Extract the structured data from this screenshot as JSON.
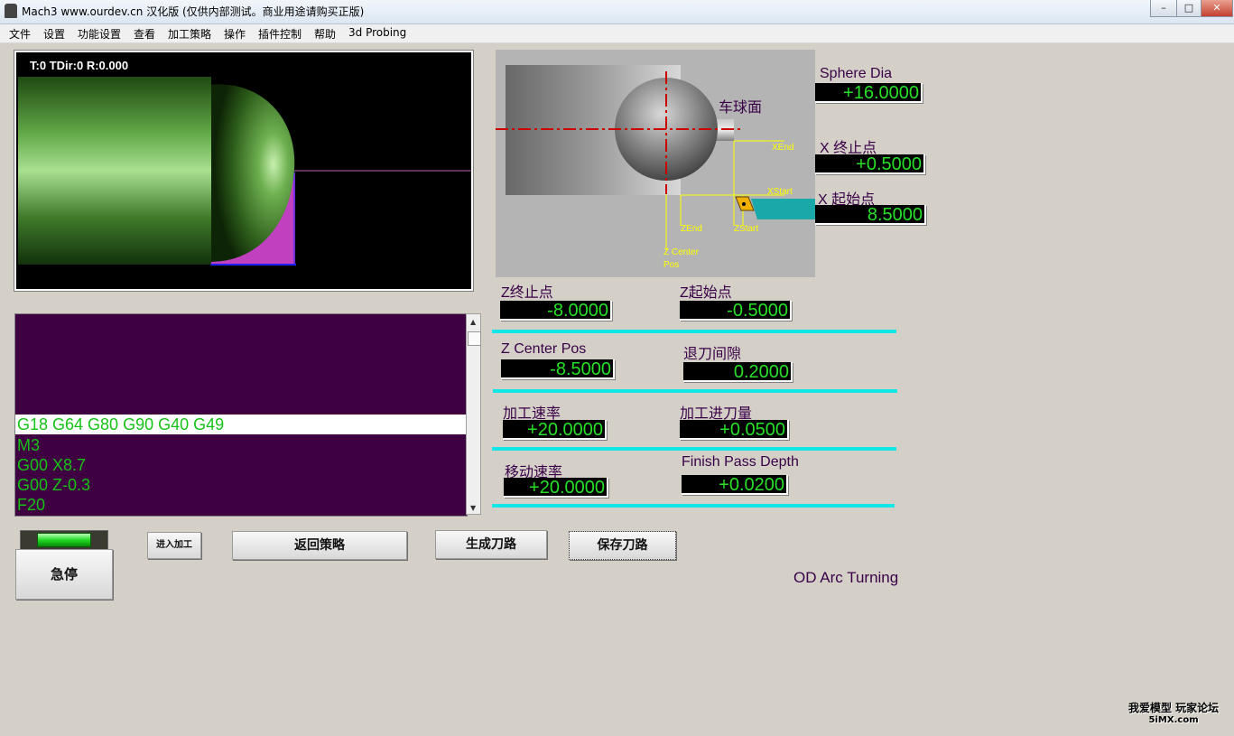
{
  "window": {
    "title": "Mach3 www.ourdev.cn 汉化版 (仅供内部测试。商业用途请购买正版)",
    "minimize": "–",
    "maximize": "□",
    "close": "✕"
  },
  "menu": {
    "items": [
      "文件",
      "设置",
      "功能设置",
      "查看",
      "加工策略",
      "操作",
      "插件控制",
      "帮助",
      "3d Probing"
    ]
  },
  "toolpath": {
    "status": "T:0 TDir:0 R:0.000"
  },
  "gcode": {
    "current": "G18 G64 G80 G90 G40 G49",
    "lines": [
      "M3",
      "G00 X8.7",
      "G00 Z-0.3",
      "F20"
    ]
  },
  "diagram": {
    "title": "车球面",
    "labels": {
      "xend": "XEnd",
      "xstart": "XStart",
      "zend": "ZEnd",
      "zstart": "ZStart",
      "zcenter_1": "Z Center",
      "zcenter_2": "Pos"
    }
  },
  "fields": {
    "sphere_dia": {
      "label": "Sphere Dia",
      "value": "+16.0000"
    },
    "x_end": {
      "label": "X 终止点",
      "value": "+0.5000"
    },
    "x_start": {
      "label": "X 起始点",
      "value": "8.5000"
    },
    "z_end": {
      "label": "Z终止点",
      "value": "-8.0000"
    },
    "z_start": {
      "label": "Z起始点",
      "value": "-0.5000"
    },
    "z_center": {
      "label": "Z Center Pos",
      "value": "-8.5000"
    },
    "retract": {
      "label": "退刀间隙",
      "value": "0.2000"
    },
    "feed_rate": {
      "label": "加工速率",
      "value": "+20.0000"
    },
    "cut_depth": {
      "label": "加工进刀量",
      "value": "+0.0500"
    },
    "move_rate": {
      "label": "移动速率",
      "value": "+20.0000"
    },
    "finish_depth": {
      "label": "Finish Pass Depth",
      "value": "+0.0200"
    }
  },
  "buttons": {
    "enter": "进入加工",
    "back": "返回策略",
    "generate": "生成刀路",
    "save": "保存刀路",
    "estop": "急停"
  },
  "mode_label": "OD Arc Turning",
  "watermark": {
    "line1": "我爱模型 玩家论坛",
    "line2": "5iMX.com"
  },
  "colors": {
    "dro_text": "#28e028",
    "dro_bg": "#000000",
    "label": "#3a0048",
    "separator": "#13e6e6",
    "gcode_bg": "#3f0041",
    "led_on": "#22d822"
  }
}
